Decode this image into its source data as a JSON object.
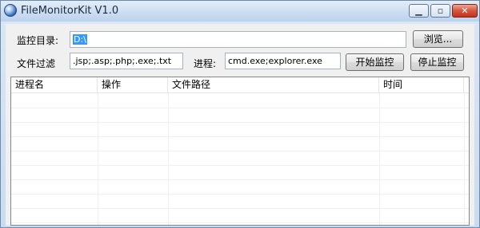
{
  "window": {
    "title": "FileMonitorKit V1.0",
    "icons": {
      "app": "app-globe-icon",
      "minimize": "minimize-icon",
      "maximize": "maximize-icon",
      "close": "close-icon"
    },
    "accent_close": "#c2321c"
  },
  "form": {
    "dir_label": "监控目录:",
    "dir_value": "D:\\",
    "browse_label": "浏览...",
    "filter_label": "文件过滤",
    "filter_value": ".jsp;.asp;.php;.exe;.txt",
    "process_label": "进程:",
    "process_value": "cmd.exe;explorer.exe",
    "start_label": "开始监控",
    "stop_label": "停止监控"
  },
  "list": {
    "columns": [
      "进程名",
      "操作",
      "文件路径",
      "时间"
    ],
    "rows": []
  }
}
